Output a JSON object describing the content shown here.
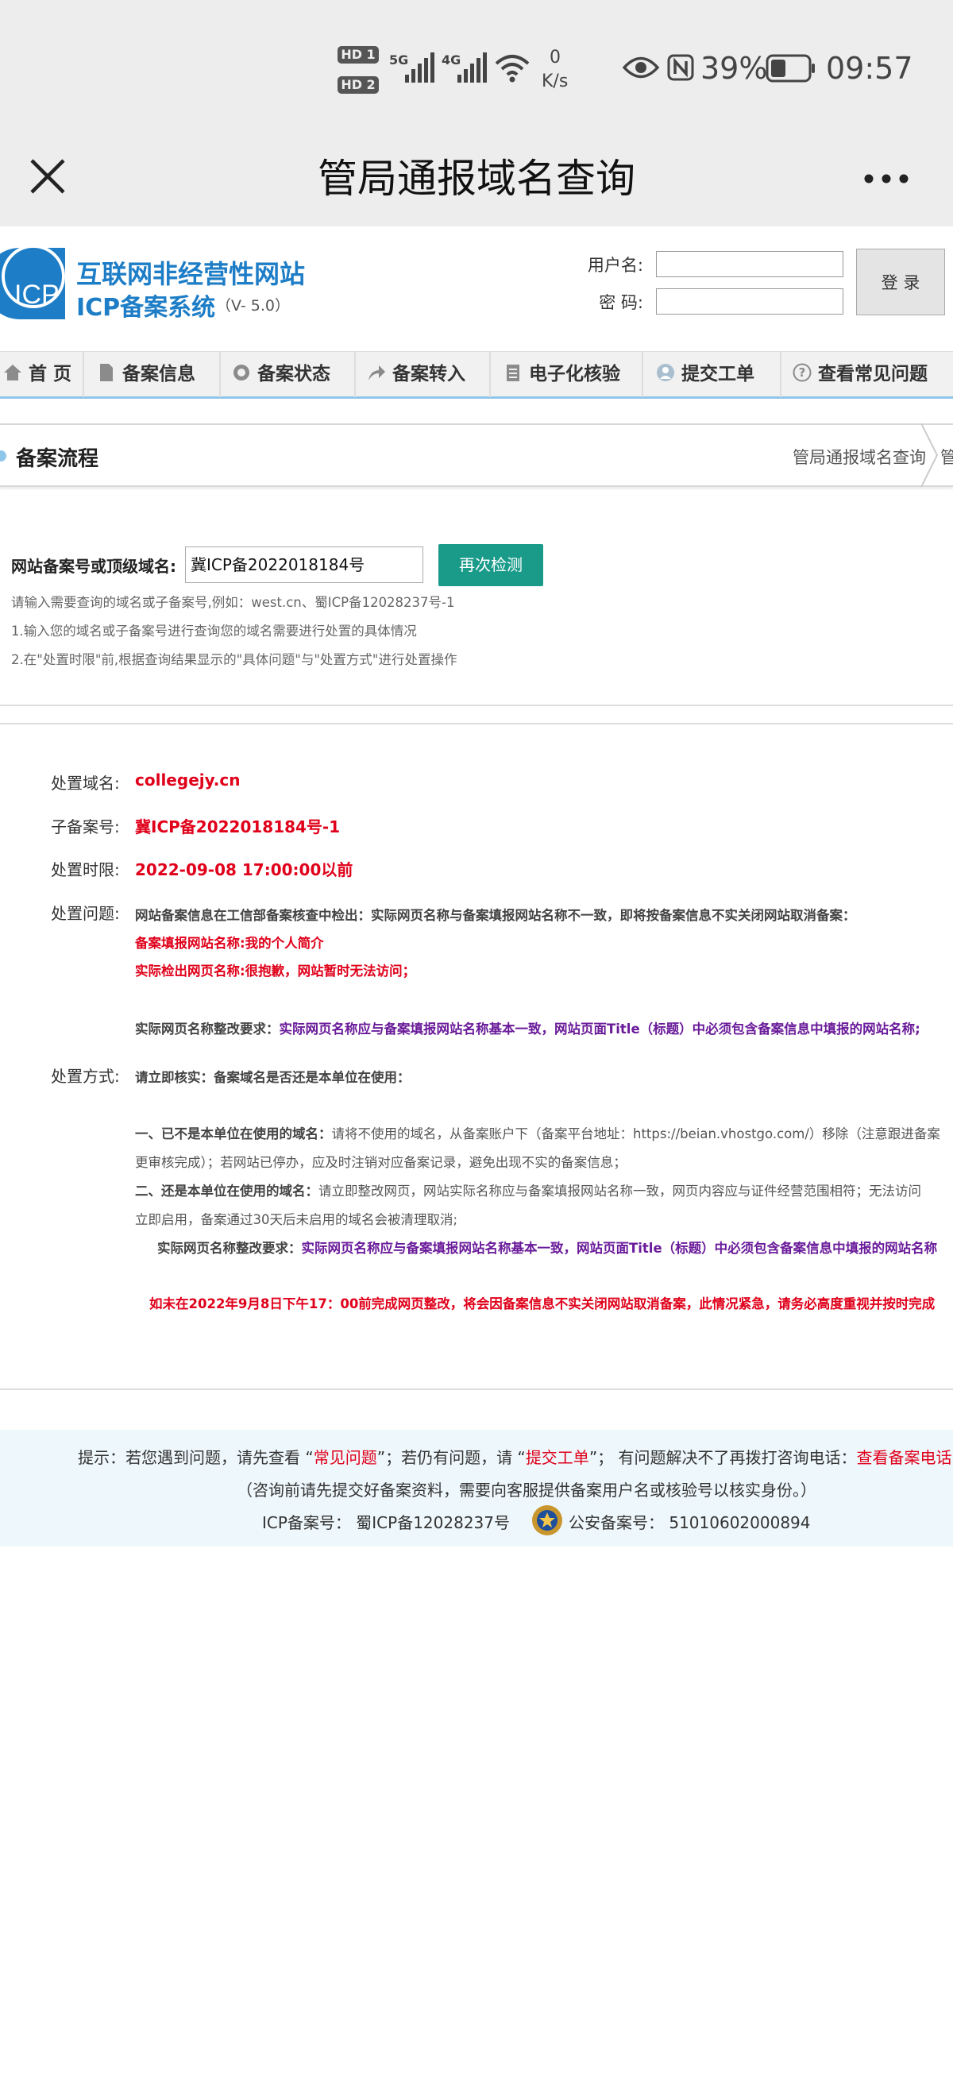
{
  "status_bar": {
    "hd1": "HD 1",
    "hd2": "HD 2",
    "net1": "5G",
    "net2": "4G",
    "speed_value": "0",
    "speed_unit": "K/s",
    "battery": "39%",
    "time": "09:57"
  },
  "title_bar": {
    "title": "管局通报域名查询"
  },
  "site": {
    "logo": "ICP",
    "name_line1": "互联网非经营性网站",
    "name_line2": "ICP备案系统",
    "version": "（V- 5.0）"
  },
  "login": {
    "username_label": "用户名:",
    "password_label": "密 码:",
    "button": "登 录"
  },
  "nav": {
    "items": [
      {
        "label": "首 页"
      },
      {
        "label": "备案信息"
      },
      {
        "label": "备案状态"
      },
      {
        "label": "备案转入"
      },
      {
        "label": "电子化核验"
      },
      {
        "label": "提交工单"
      },
      {
        "label": "查看常见问题"
      }
    ]
  },
  "breadcrumb": {
    "title": "备案流程",
    "path": "管局通报域名查询",
    "path_next": "管"
  },
  "query": {
    "label": "网站备案号或顶级域名:",
    "value": "冀ICP备2022018184号",
    "button": "再次检测",
    "hint1": "请输入需要查询的域名或子备案号,例如：west.cn、蜀ICP备12028237号-1",
    "hint2": "1.输入您的域名或子备案号进行查询您的域名需要进行处置的具体情况",
    "hint3": "2.在\"处置时限\"前,根据查询结果显示的\"具体问题\"与\"处置方式\"进行处置操作"
  },
  "result": {
    "domain_label": "处置域名:",
    "domain": "collegejy.cn",
    "sub_label": "子备案号:",
    "sub_no": "冀ICP备2022018184号-1",
    "deadline_label": "处置时限:",
    "deadline": "2022-09-08 17:00:00以前",
    "issue_label": "处置问题:",
    "issue_main": "网站备案信息在工信部备案核查中检出：实际网页名称与备案填报网站名称不一致，即将按备案信息不实关闭网站取消备案：",
    "issue_filed": "备案填报网站名称:我的个人简介",
    "issue_actual": "实际检出网页名称:很抱歉，网站暂时无法访问；",
    "rect_label": "实际网页名称整改要求：",
    "rect_text": "实际网页名称应与备案填报网站名称基本一致，网站页面Title（标题）中必须包含备案信息中填报的网站名称;",
    "method_label": "处置方式:",
    "method_intro": "请立即核实：备案域名是否还是本单位在使用：",
    "m1_head": "一、已不是本单位在使用的域名：",
    "m1_text": "请将不使用的域名，从备案账户下（备案平台地址：https://beian.vhostgo.com/）移除（注意跟进备案",
    "m1_text2": "更审核完成）；若网站已停办，应及时注销对应备案记录，避免出现不实的备案信息；",
    "m2_head": "二、还是本单位在使用的域名：",
    "m2_text": "请立即整改网页，网站实际名称应与备案填报网站名称一致，网页内容应与证件经营范围相符；无法访问",
    "m2_text2": "立即启用，备案通过30天后未启用的域名会被清理取消;",
    "rect2_label": "实际网页名称整改要求：",
    "rect2_text": "实际网页名称应与备案填报网站名称基本一致，网站页面Title（标题）中必须包含备案信息中填报的网站名称",
    "warning": "如未在2022年9月8日下午17：00前完成网页整改，将会因备案信息不实关闭网站取消备案，此情况紧急，请务必高度重视并按时完成"
  },
  "footer": {
    "tip_a": "提示：若您遇到问题，请先查看 “",
    "faq": "常见问题",
    "tip_b": "”；若仍有问题，请 “",
    "ticket": "提交工单",
    "tip_c": "”； 有问题解决不了再拨打咨询电话：",
    "phone": "查看备案电话",
    "line2": "（咨询前请先提交好备案资料，需要向客服提供备案用户名或核验号以核实身份。）",
    "icp": "ICP备案号：  蜀ICP备12028237号",
    "police": "公安备案号：  51010602000894"
  },
  "colors": {
    "brand": "#1d7dc6",
    "button": "#1a9b8a",
    "alert": "#e0001a",
    "emphasis": "#6a1b9a"
  }
}
